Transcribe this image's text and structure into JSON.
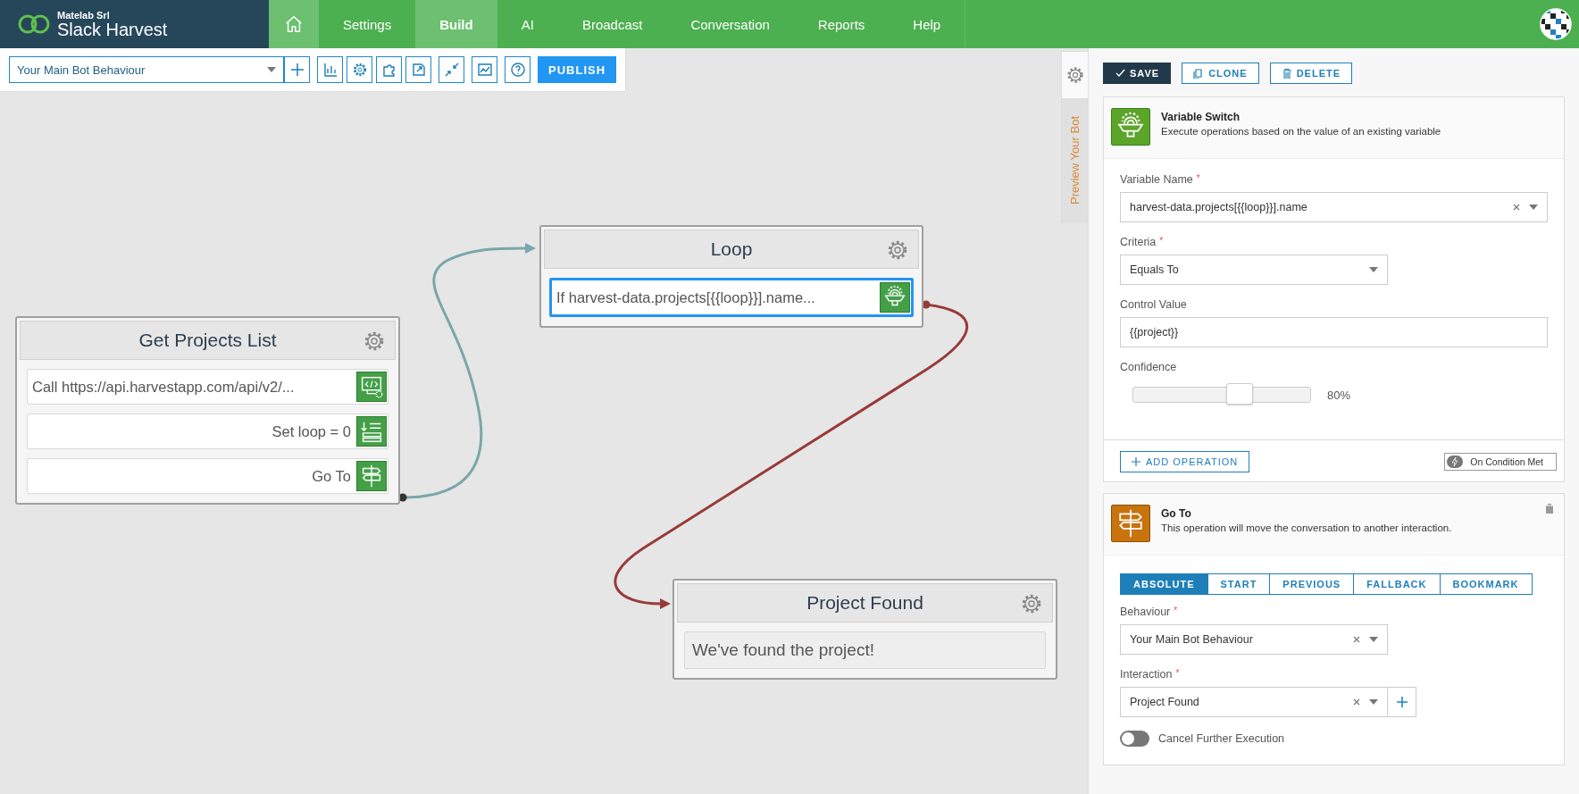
{
  "app": {
    "company": "Matelab Srl",
    "name": "Slack Harvest"
  },
  "nav": [
    {
      "label": "Settings",
      "selected": false
    },
    {
      "label": "Build",
      "selected": true
    },
    {
      "label": "AI",
      "selected": false
    },
    {
      "label": "Broadcast",
      "selected": false
    },
    {
      "label": "Conversation",
      "selected": false
    },
    {
      "label": "Reports",
      "selected": false
    },
    {
      "label": "Help",
      "selected": false
    }
  ],
  "toolbar": {
    "behaviour": "Your Main Bot Behaviour",
    "publish": "PUBLISH"
  },
  "canvas": {
    "nodes": [
      {
        "title": "Get Projects List",
        "items": [
          {
            "kind": "code",
            "text": "Call https://api.harvestapp.com/api/v2/...",
            "selected": false
          },
          {
            "kind": "set",
            "text": "Set loop = 0",
            "selected": false
          },
          {
            "kind": "goto",
            "text": "Go To",
            "selected": false
          }
        ]
      },
      {
        "title": "Loop",
        "items": [
          {
            "kind": "switch",
            "text": "If harvest-data.projects[{{loop}}].name...",
            "selected": true
          }
        ]
      },
      {
        "title": "Project Found",
        "items": [
          {
            "kind": "message",
            "text": "We've found the project!",
            "selected": false
          }
        ]
      }
    ],
    "connectors": [
      {
        "color": "#7aa7a8"
      },
      {
        "color": "#983a3a"
      }
    ]
  },
  "panel": {
    "tabs": [
      {
        "kind": "settings",
        "selected": true
      },
      {
        "kind": "preview",
        "label": "Preview Your Bot",
        "selected": false
      }
    ],
    "actions": [
      {
        "kind": "save",
        "label": "SAVE"
      },
      {
        "kind": "clone",
        "label": "CLONE"
      },
      {
        "kind": "delete",
        "label": "DELETE"
      }
    ],
    "operations": [
      {
        "kind": "switch",
        "title": "Variable Switch",
        "description": "Execute operations based on the value of an existing variable",
        "fields": [
          {
            "kind": "select",
            "label": "Variable Name",
            "mark": "*",
            "value": "harvest-data.projects[{{loop}}].name",
            "clearable": true
          },
          {
            "kind": "select",
            "label": "Criteria",
            "mark": "*",
            "value": "Equals To",
            "clearable": false
          },
          {
            "kind": "text",
            "label": "Control Value",
            "value": "{{project}}"
          },
          {
            "kind": "slider",
            "label": "Confidence",
            "level": 0.6,
            "reading": "80%"
          }
        ],
        "add_operation": "ADD OPERATION",
        "condition": "On Condition Met"
      },
      {
        "kind": "goto",
        "title": "Go To",
        "description": "This operation will move the conversation to another interaction.",
        "modes": [
          {
            "label": "ABSOLUTE",
            "selected": true
          },
          {
            "label": "START",
            "selected": false
          },
          {
            "label": "PREVIOUS",
            "selected": false
          },
          {
            "label": "FALLBACK",
            "selected": false
          },
          {
            "label": "BOOKMARK",
            "selected": false
          }
        ],
        "fields": [
          {
            "kind": "select",
            "label": "Behaviour",
            "mark": "*",
            "value": "Your Main Bot Behaviour",
            "clearable": true
          },
          {
            "kind": "select",
            "label": "Interaction",
            "mark": "*",
            "value": "Project Found",
            "clearable": true,
            "addable": true
          },
          {
            "kind": "toggle",
            "label": "Cancel Further Execution",
            "on": false
          }
        ]
      }
    ]
  }
}
